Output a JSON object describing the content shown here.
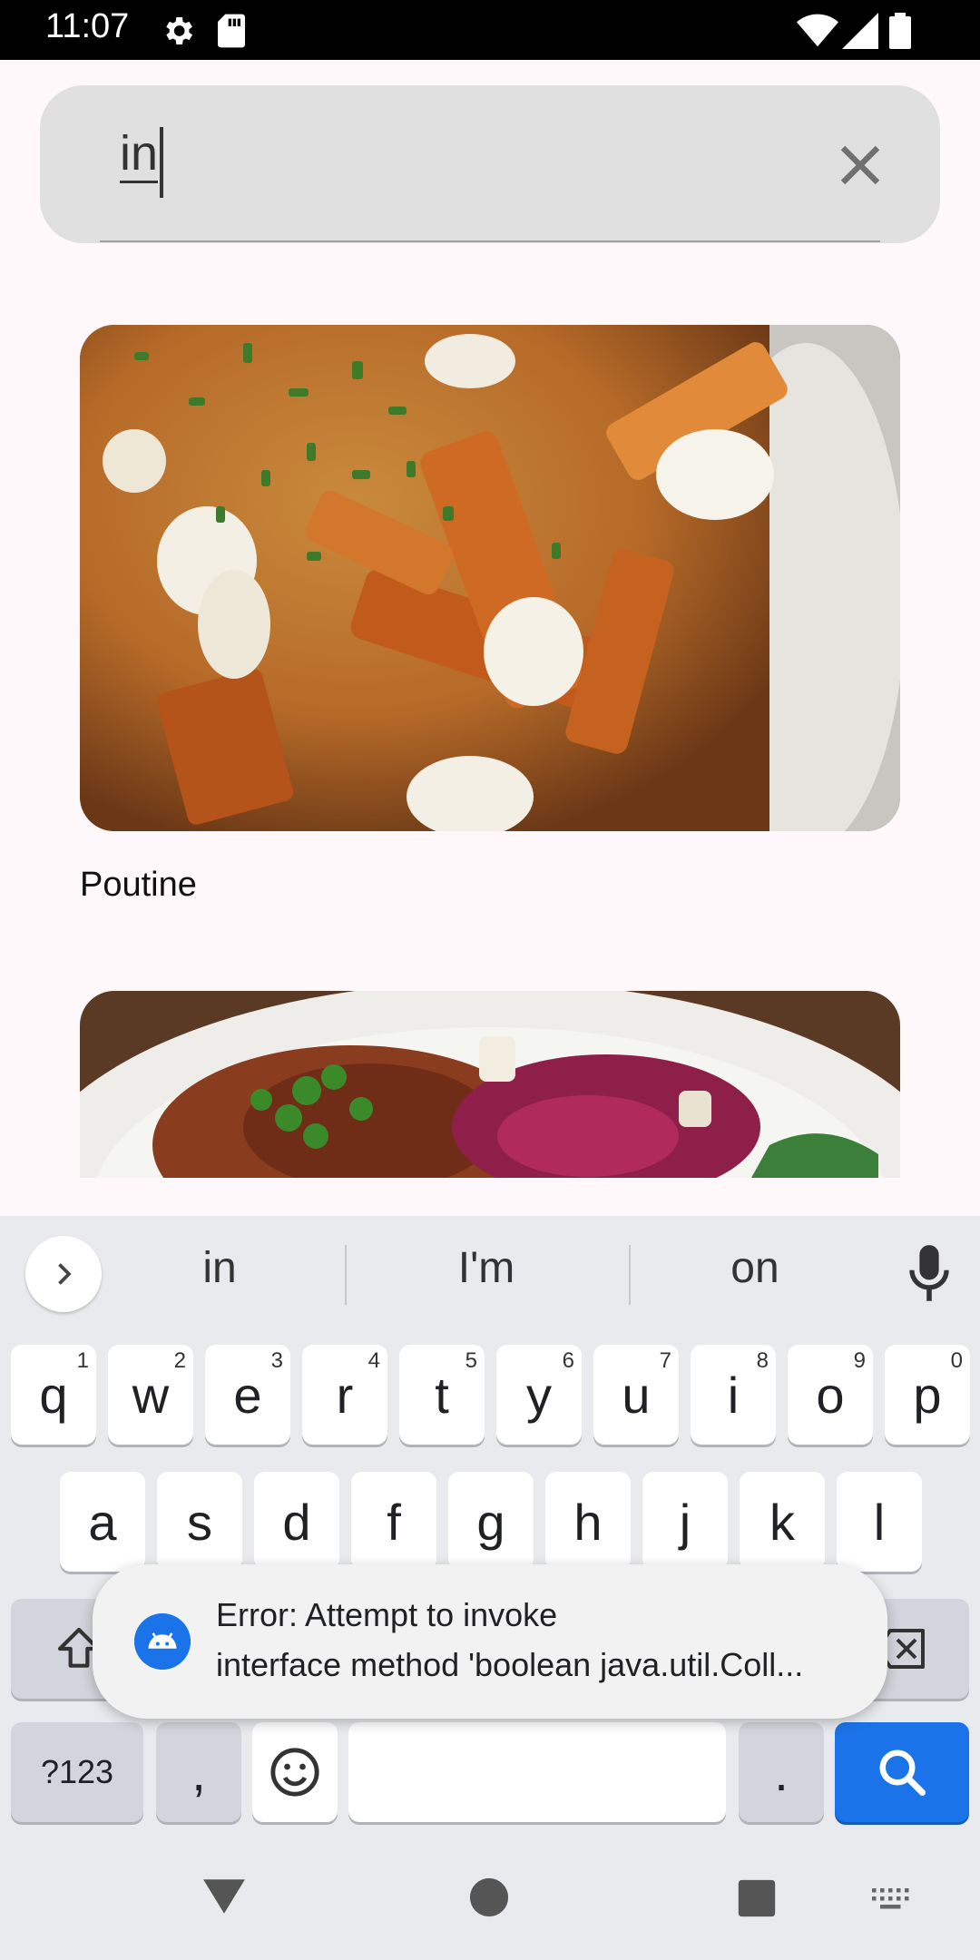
{
  "status_bar": {
    "time": "11:07",
    "icons": [
      "settings-gear-icon",
      "sd-card-icon",
      "wifi-icon",
      "cellular-signal-icon",
      "battery-icon"
    ]
  },
  "search": {
    "query": "in",
    "clear_icon": "close-icon"
  },
  "results": [
    {
      "title": "Poutine",
      "image": "poutine-photo"
    },
    {
      "title": "",
      "image": "braised-meat-with-red-cabbage-photo"
    }
  ],
  "keyboard": {
    "suggestions": [
      "in",
      "I'm",
      "on"
    ],
    "row1": [
      {
        "key": "q",
        "hint": "1"
      },
      {
        "key": "w",
        "hint": "2"
      },
      {
        "key": "e",
        "hint": "3"
      },
      {
        "key": "r",
        "hint": "4"
      },
      {
        "key": "t",
        "hint": "5"
      },
      {
        "key": "y",
        "hint": "6"
      },
      {
        "key": "u",
        "hint": "7"
      },
      {
        "key": "i",
        "hint": "8"
      },
      {
        "key": "o",
        "hint": "9"
      },
      {
        "key": "p",
        "hint": "0"
      }
    ],
    "row2": [
      "a",
      "s",
      "d",
      "f",
      "g",
      "h",
      "j",
      "k",
      "l"
    ],
    "symbols_label": "?123",
    "comma_label": ",",
    "period_label": "."
  },
  "toast": {
    "line1": "Error: Attempt to invoke",
    "line2": "interface method 'boolean java.util.Coll..."
  },
  "colors": {
    "accent": "#1a73e8",
    "search_bg": "#e0e0e0",
    "keyboard_bg": "#e8eaed"
  }
}
